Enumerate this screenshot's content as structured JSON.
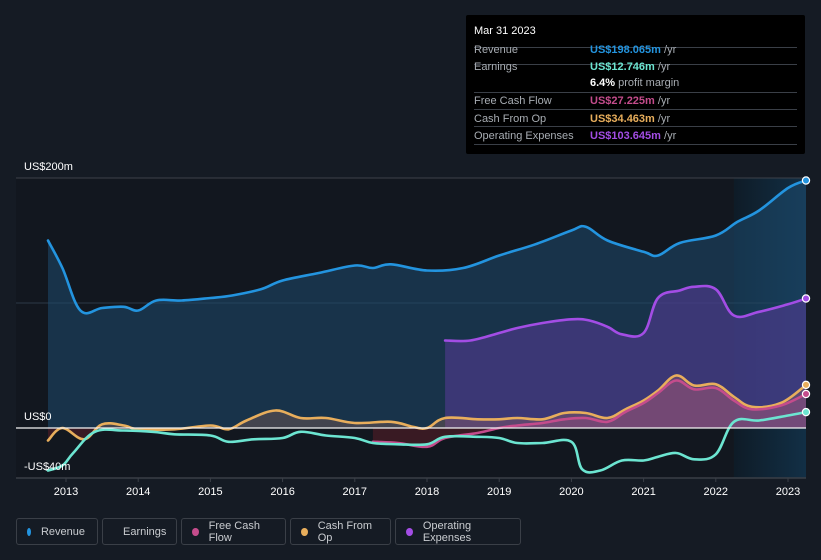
{
  "tooltip": {
    "date": "Mar 31 2023",
    "rows": [
      {
        "label": "Revenue",
        "value": "US$198.065m",
        "unit": "/yr",
        "color": "#2394df"
      },
      {
        "label": "Earnings",
        "value": "US$12.746m",
        "unit": "/yr",
        "color": "#6ce5d1"
      },
      {
        "label": "Free Cash Flow",
        "value": "US$27.225m",
        "unit": "/yr",
        "color": "#c44c8c"
      },
      {
        "label": "Cash From Op",
        "value": "US$34.463m",
        "unit": "/yr",
        "color": "#e8ae5c"
      },
      {
        "label": "Operating Expenses",
        "value": "US$103.645m",
        "unit": "/yr",
        "color": "#a34de5"
      }
    ],
    "profit_margin_value": "6.4%",
    "profit_margin_label": "profit margin"
  },
  "legend": [
    {
      "label": "Revenue",
      "color": "#2394df"
    },
    {
      "label": "Earnings",
      "color": "#6ce5d1"
    },
    {
      "label": "Free Cash Flow",
      "color": "#c44c8c"
    },
    {
      "label": "Cash From Op",
      "color": "#e8ae5c"
    },
    {
      "label": "Operating Expenses",
      "color": "#a34de5"
    }
  ],
  "chart_data": {
    "type": "area",
    "title": "",
    "xlabel": "",
    "ylabel": "",
    "y_tick_labels": [
      "US$200m",
      "US$0",
      "-US$40m"
    ],
    "y_ticks": [
      200,
      0,
      -40
    ],
    "ylim": [
      -40,
      200
    ],
    "xlim": [
      2012.3,
      2023.25
    ],
    "x_tick_labels": [
      "2013",
      "2014",
      "2015",
      "2016",
      "2017",
      "2018",
      "2019",
      "2020",
      "2021",
      "2022",
      "2023"
    ],
    "x_ticks": [
      2013,
      2014,
      2015,
      2016,
      2017,
      2018,
      2019,
      2020,
      2021,
      2022,
      2023
    ],
    "highlight_range": [
      2022.25,
      2023.25
    ],
    "grid": true,
    "legend_position": "bottom",
    "series": [
      {
        "name": "Revenue",
        "color": "#2394df",
        "x": [
          2012.75,
          2012.95,
          2013.2,
          2013.5,
          2013.8,
          2014.0,
          2014.25,
          2014.6,
          2015.0,
          2015.3,
          2015.7,
          2016.0,
          2016.5,
          2017.0,
          2017.25,
          2017.5,
          2018.0,
          2018.5,
          2019.0,
          2019.5,
          2020.0,
          2020.2,
          2020.5,
          2021.0,
          2021.2,
          2021.5,
          2022.0,
          2022.3,
          2022.6,
          2023.0,
          2023.25
        ],
        "values": [
          150,
          128,
          94,
          96,
          97,
          94,
          102,
          102,
          104,
          106,
          111,
          118,
          124,
          130,
          128,
          131,
          126,
          128,
          138,
          147,
          158,
          161,
          150,
          141,
          138,
          148,
          154,
          165,
          174,
          192,
          198
        ]
      },
      {
        "name": "Earnings",
        "color": "#6ce5d1",
        "x": [
          2012.75,
          2012.95,
          2013.1,
          2013.4,
          2013.8,
          2014.2,
          2014.5,
          2015.0,
          2015.25,
          2015.6,
          2016.0,
          2016.25,
          2016.6,
          2017.0,
          2017.25,
          2017.6,
          2018.0,
          2018.25,
          2018.7,
          2019.0,
          2019.25,
          2019.6,
          2020.0,
          2020.15,
          2020.4,
          2020.7,
          2021.0,
          2021.2,
          2021.45,
          2021.7,
          2022.0,
          2022.25,
          2022.6,
          2023.0,
          2023.25
        ],
        "values": [
          -34,
          -30,
          -20,
          -3,
          -2,
          -3,
          -5,
          -6,
          -11,
          -9,
          -8,
          -3,
          -6,
          -8,
          -12,
          -13,
          -13,
          -7,
          -7,
          -8,
          -12,
          -12,
          -11,
          -33,
          -34,
          -26,
          -26,
          -23,
          -20,
          -25,
          -21,
          5,
          6,
          10,
          12.7
        ]
      },
      {
        "name": "Free Cash Flow",
        "color": "#c44c8c",
        "x": [
          2017.25,
          2017.6,
          2018.0,
          2018.25,
          2018.7,
          2019.0,
          2019.25,
          2019.6,
          2019.9,
          2020.2,
          2020.5,
          2020.75,
          2021.0,
          2021.2,
          2021.45,
          2021.7,
          2022.0,
          2022.25,
          2022.5,
          2022.9,
          2023.25
        ],
        "values": [
          -11,
          -12,
          -15,
          -8,
          -4,
          0,
          2,
          4,
          7,
          8,
          5,
          13,
          20,
          28,
          38,
          31,
          32,
          22,
          15,
          18,
          27.2
        ]
      },
      {
        "name": "Cash From Op",
        "color": "#e8ae5c",
        "x": [
          2012.75,
          2012.95,
          2013.25,
          2013.5,
          2013.8,
          2014.0,
          2014.5,
          2015.0,
          2015.25,
          2015.5,
          2015.9,
          2016.25,
          2016.6,
          2017.0,
          2017.5,
          2017.8,
          2018.0,
          2018.25,
          2018.7,
          2019.0,
          2019.25,
          2019.6,
          2019.9,
          2020.2,
          2020.5,
          2020.75,
          2021.0,
          2021.2,
          2021.45,
          2021.7,
          2022.0,
          2022.25,
          2022.5,
          2022.9,
          2023.25
        ],
        "values": [
          -10,
          0,
          -9,
          3,
          2,
          -1,
          -1,
          2,
          -1,
          6,
          14,
          8,
          8,
          4,
          5,
          1,
          0,
          8,
          7,
          7,
          8,
          7,
          12,
          12,
          8,
          15,
          22,
          30,
          42,
          34,
          35,
          25,
          17,
          20,
          34.5
        ]
      },
      {
        "name": "Operating Expenses",
        "color": "#a34de5",
        "x": [
          2018.25,
          2018.6,
          2019.0,
          2019.25,
          2019.6,
          2020.0,
          2020.25,
          2020.5,
          2020.7,
          2021.0,
          2021.2,
          2021.5,
          2021.7,
          2022.0,
          2022.25,
          2022.6,
          2023.0,
          2023.25
        ],
        "values": [
          70,
          70,
          76,
          80,
          84,
          87,
          86,
          81,
          75,
          76,
          104,
          110,
          113,
          111,
          90,
          93,
          99,
          103.6
        ]
      }
    ]
  }
}
